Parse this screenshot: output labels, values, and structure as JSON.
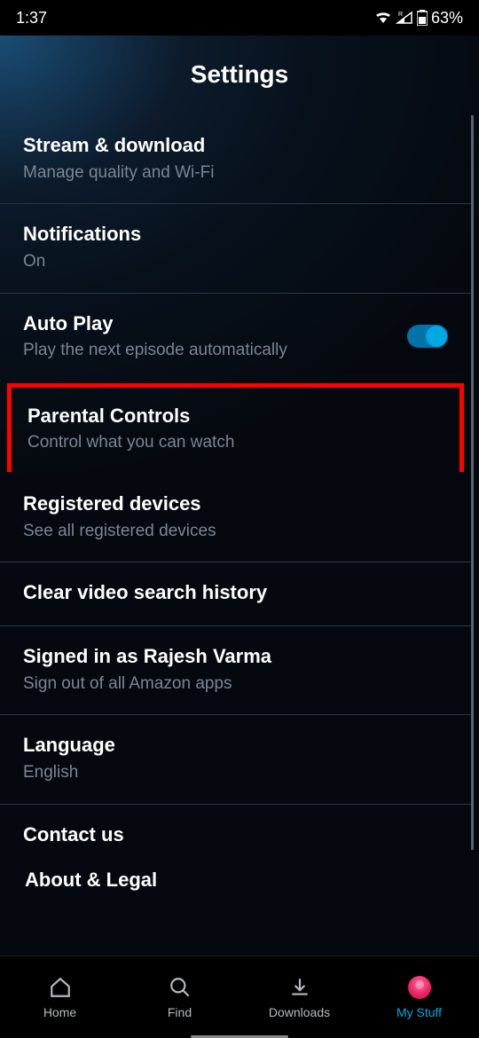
{
  "status_bar": {
    "time": "1:37",
    "battery": "63%",
    "network_indicator": "R"
  },
  "page_title": "Settings",
  "settings": [
    {
      "title": "Stream & download",
      "sub": "Manage quality and Wi-Fi"
    },
    {
      "title": "Notifications",
      "sub": "On"
    },
    {
      "title": "Auto Play",
      "sub": "Play the next episode automatically",
      "toggle": true
    },
    {
      "title": "Parental Controls",
      "sub": "Control what you can watch",
      "highlighted": true
    },
    {
      "title": "Registered devices",
      "sub": "See all registered devices"
    },
    {
      "title": "Clear video search history",
      "sub": ""
    },
    {
      "title": "Signed in as Rajesh Varma",
      "sub": "Sign out of all Amazon apps"
    },
    {
      "title": "Language",
      "sub": "English"
    },
    {
      "title": "Contact us",
      "sub": ""
    },
    {
      "title": "About & Legal",
      "sub": ""
    }
  ],
  "nav": {
    "items": [
      {
        "label": "Home"
      },
      {
        "label": "Find"
      },
      {
        "label": "Downloads"
      },
      {
        "label": "My Stuff",
        "active": true
      }
    ]
  }
}
